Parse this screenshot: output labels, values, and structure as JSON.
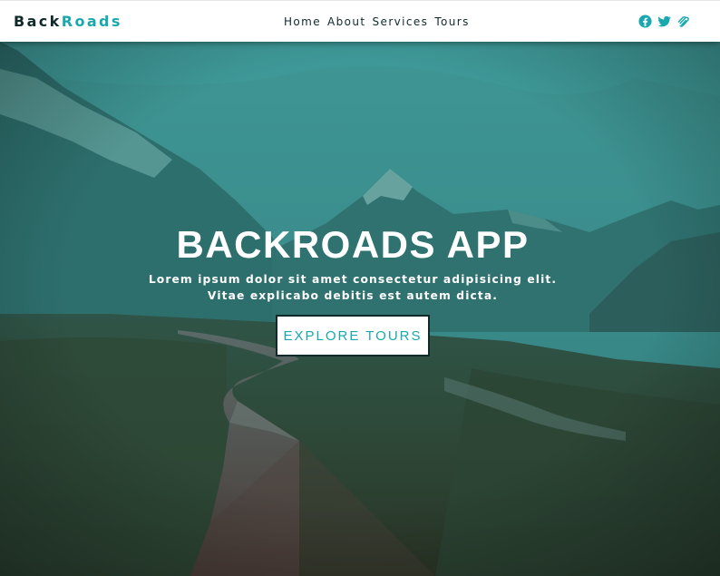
{
  "brand": {
    "part1": "Back",
    "part2": "Roads"
  },
  "nav": {
    "links": [
      "Home",
      "About",
      "Services",
      "Tours"
    ]
  },
  "social": {
    "icons": [
      "facebook-icon",
      "twitter-icon",
      "squarespace-icon"
    ]
  },
  "hero": {
    "title": "BACKROADS APP",
    "text": "Lorem ipsum dolor sit amet consectetur adipisicing elit. Vitae explicabo debitis est autem dicta.",
    "button_label": "EXPLORE TOURS"
  },
  "colors": {
    "accent": "#18a8ad",
    "dark": "#102a2a",
    "navbar": "#ffffff"
  }
}
